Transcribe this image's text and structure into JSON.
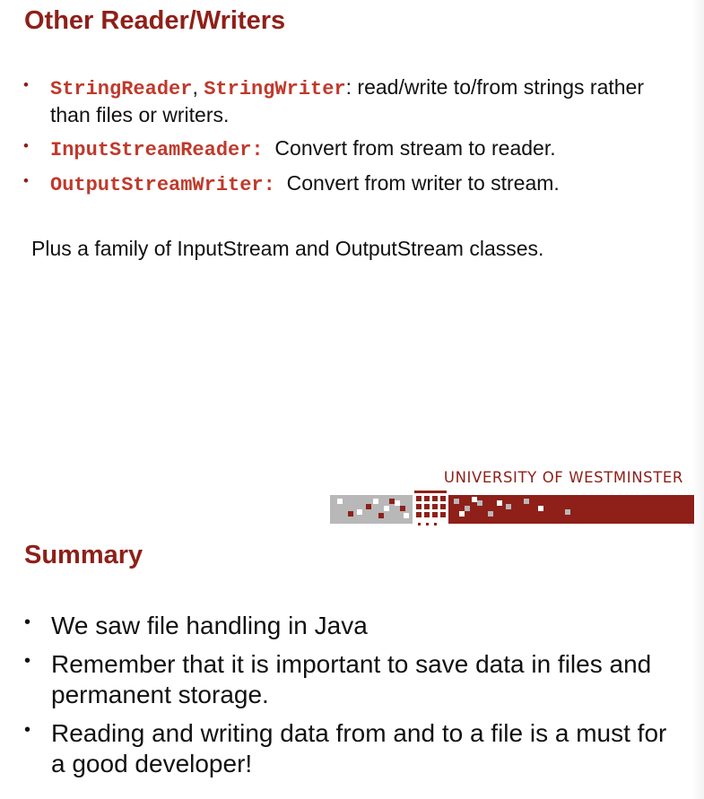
{
  "slide1": {
    "title": "Other Reader/Writers",
    "items": [
      {
        "code1": "StringReader",
        "sep": ", ",
        "code2": "StringWriter",
        "text": ": read/write to/from strings rather than files or writers."
      },
      {
        "code1": "InputStreamReader:",
        "text": "  Convert from stream to reader."
      },
      {
        "code1": "OutputStreamWriter:",
        "text": "  Convert from writer to stream."
      }
    ],
    "note": "Plus a family of InputStream and OutputStream classes."
  },
  "logo": {
    "text": "UNIVERSITY OF WESTMINSTER",
    "brand_color": "#8e2019",
    "grey_color": "#b8b8b8"
  },
  "slide2": {
    "title": "Summary",
    "items": [
      "We saw file handling in Java",
      "Remember that it is important to save data in files and permanent storage.",
      "Reading and writing data from and to a file is a must for a good developer!"
    ]
  }
}
